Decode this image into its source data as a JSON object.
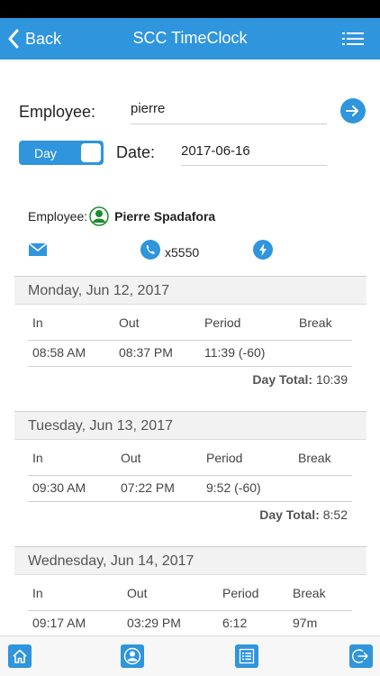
{
  "nav": {
    "back_label": "Back",
    "title": "SCC TimeClock"
  },
  "form": {
    "employee_label": "Employee:",
    "employee_value": "pierre",
    "toggle_label": "Day",
    "date_label": "Date:",
    "date_value": "2017-06-16"
  },
  "employee": {
    "label": "Employee:",
    "name": "Pierre Spadafora",
    "extension": "x5550"
  },
  "days": [
    {
      "header": "Monday, Jun 12, 2017",
      "columns": [
        "In",
        "Out",
        "Period",
        "Break"
      ],
      "rows": [
        {
          "in": "08:58 AM",
          "out": "08:37 PM",
          "period": "11:39 (-60)",
          "break": ""
        }
      ],
      "total_label": "Day Total:",
      "total_value": "10:39"
    },
    {
      "header": "Tuesday, Jun 13, 2017",
      "columns": [
        "In",
        "Out",
        "Period",
        "Break"
      ],
      "rows": [
        {
          "in": "09:30 AM",
          "out": "07:22 PM",
          "period": "9:52 (-60)",
          "break": ""
        }
      ],
      "total_label": "Day Total:",
      "total_value": "8:52"
    },
    {
      "header": "Wednesday, Jun 14, 2017",
      "columns": [
        "In",
        "Out",
        "Period",
        "Break"
      ],
      "rows": [
        {
          "in": "09:17 AM",
          "out": "03:29 PM",
          "period": "6:12",
          "break": "97m"
        }
      ],
      "total_label": "",
      "total_value": ""
    }
  ],
  "tabs": [
    "home-icon",
    "profile-icon",
    "list-icon",
    "logout-icon"
  ],
  "colors": {
    "accent": "#2f95dc",
    "avatar_green": "#1e8c2e",
    "section_bg": "#f2f2f2"
  }
}
